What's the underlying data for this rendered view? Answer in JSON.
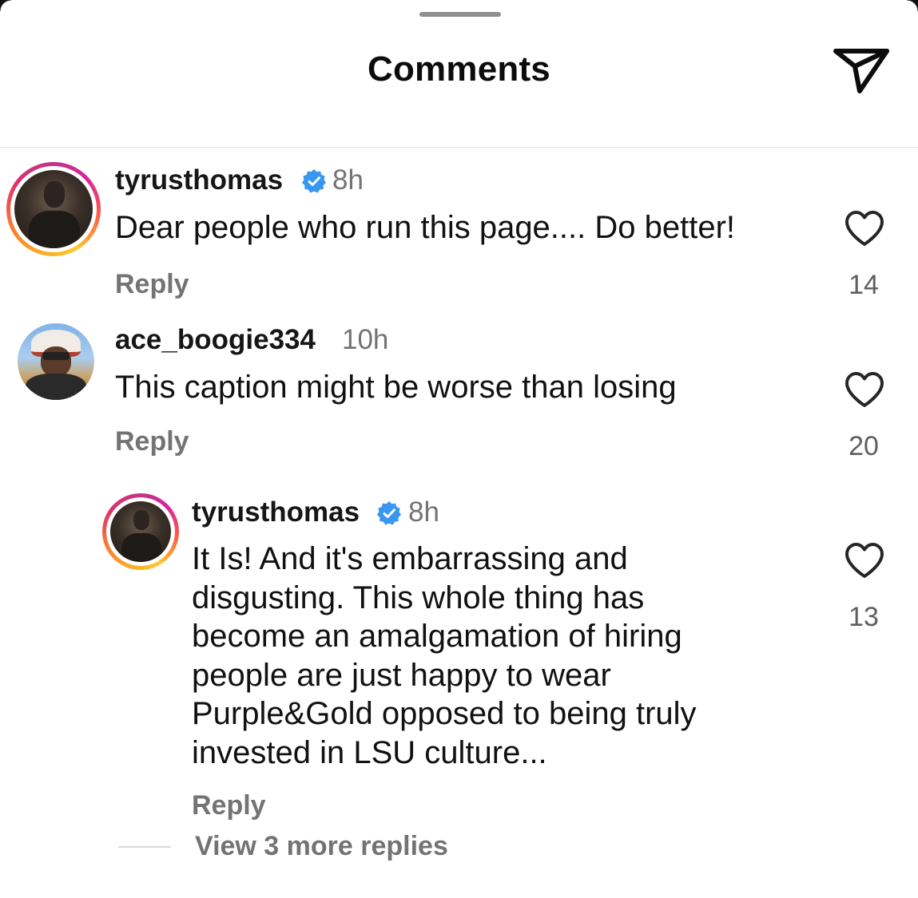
{
  "header": {
    "title": "Comments",
    "share_icon": "paper-plane-icon"
  },
  "comments": [
    {
      "username": "tyrusthomas",
      "verified": true,
      "time": "8h",
      "text": "Dear people who run this page.... Do better!",
      "reply_label": "Reply",
      "likes": "14",
      "avatar_story_ring": true
    },
    {
      "username": "ace_boogie334",
      "verified": false,
      "time": "10h",
      "text": "This caption might be worse than losing",
      "reply_label": "Reply",
      "likes": "20",
      "avatar_story_ring": false,
      "replies": [
        {
          "username": "tyrusthomas",
          "verified": true,
          "time": "8h",
          "text_lines": [
            "It Is! And it's embarrassing and",
            "disgusting. This whole thing has",
            "become an amalgamation of hiring",
            "people are just happy to wear",
            "Purple&Gold opposed to being truly",
            "invested in LSU culture..."
          ],
          "reply_label": "Reply",
          "likes": "13",
          "avatar_story_ring": true
        }
      ],
      "view_more_label": "View 3 more replies"
    }
  ],
  "colors": {
    "verified_blue": "#3897f0",
    "secondary_text": "#737373",
    "primary_text": "#111111"
  }
}
